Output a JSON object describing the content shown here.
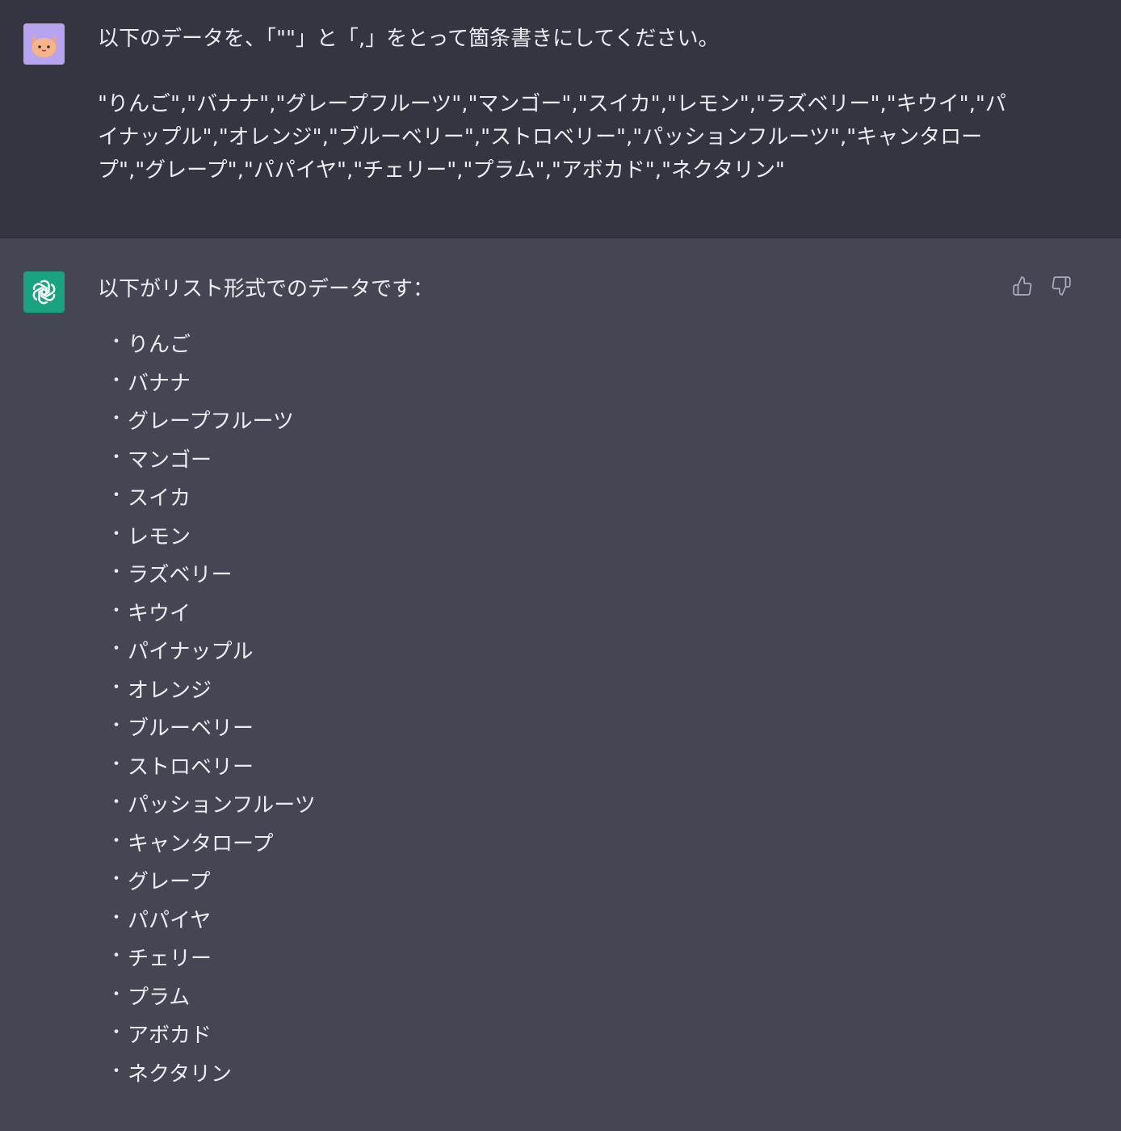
{
  "user_message": {
    "prompt": "以下のデータを、「\"\"」と「,」をとって箇条書きにしてください。",
    "data_line": "\"りんご\",\"バナナ\",\"グレープフルーツ\",\"マンゴー\",\"スイカ\",\"レモン\",\"ラズベリー\",\"キウイ\",\"パイナップル\",\"オレンジ\",\"ブルーベリー\",\"ストロベリー\",\"パッションフルーツ\",\"キャンタロープ\",\"グレープ\",\"パパイヤ\",\"チェリー\",\"プラム\",\"アボカド\",\"ネクタリン\""
  },
  "assistant_message": {
    "intro": "以下がリスト形式でのデータです：",
    "bullet": "・",
    "items": [
      "りんご",
      "バナナ",
      "グレープフルーツ",
      "マンゴー",
      "スイカ",
      "レモン",
      "ラズベリー",
      "キウイ",
      "パイナップル",
      "オレンジ",
      "ブルーベリー",
      "ストロベリー",
      "パッションフルーツ",
      "キャンタロープ",
      "グレープ",
      "パパイヤ",
      "チェリー",
      "プラム",
      "アボカド",
      "ネクタリン"
    ]
  },
  "icons": {
    "user_avatar": "cat-avatar-icon",
    "assistant_avatar": "openai-logo-icon",
    "thumbs_up": "thumbs-up-icon",
    "thumbs_down": "thumbs-down-icon"
  },
  "colors": {
    "user_bg": "#343541",
    "assistant_bg": "#444654",
    "text": "#ececf1",
    "assistant_avatar_bg": "#19a37f",
    "user_avatar_bg": "#b7a4f0"
  }
}
